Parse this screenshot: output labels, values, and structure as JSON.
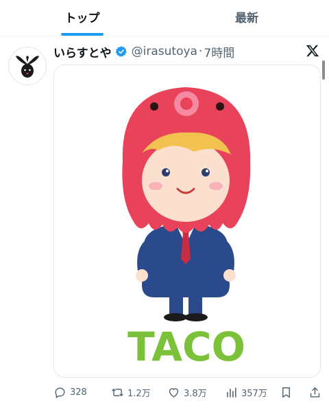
{
  "tabs": [
    {
      "label": "トップ",
      "active": true
    },
    {
      "label": "最新",
      "active": false
    }
  ],
  "post": {
    "display_name": "いらすとや",
    "handle": "@irasutoya",
    "separator": "·",
    "time": "7時間",
    "image_text": "TACO"
  },
  "actions": {
    "replies": "328",
    "reposts": "1.2万",
    "likes": "3.8万",
    "views": "357万"
  },
  "colors": {
    "accent": "#1d9bf0",
    "muted": "#536471",
    "octopus_red": "#e8435a",
    "taco_green": "#7cc13a",
    "suit_navy": "#2b4a8c"
  },
  "icons": [
    "verified-badge-icon",
    "x-logo-icon",
    "reply-icon",
    "repost-icon",
    "like-icon",
    "views-icon",
    "bookmark-icon",
    "share-icon"
  ]
}
